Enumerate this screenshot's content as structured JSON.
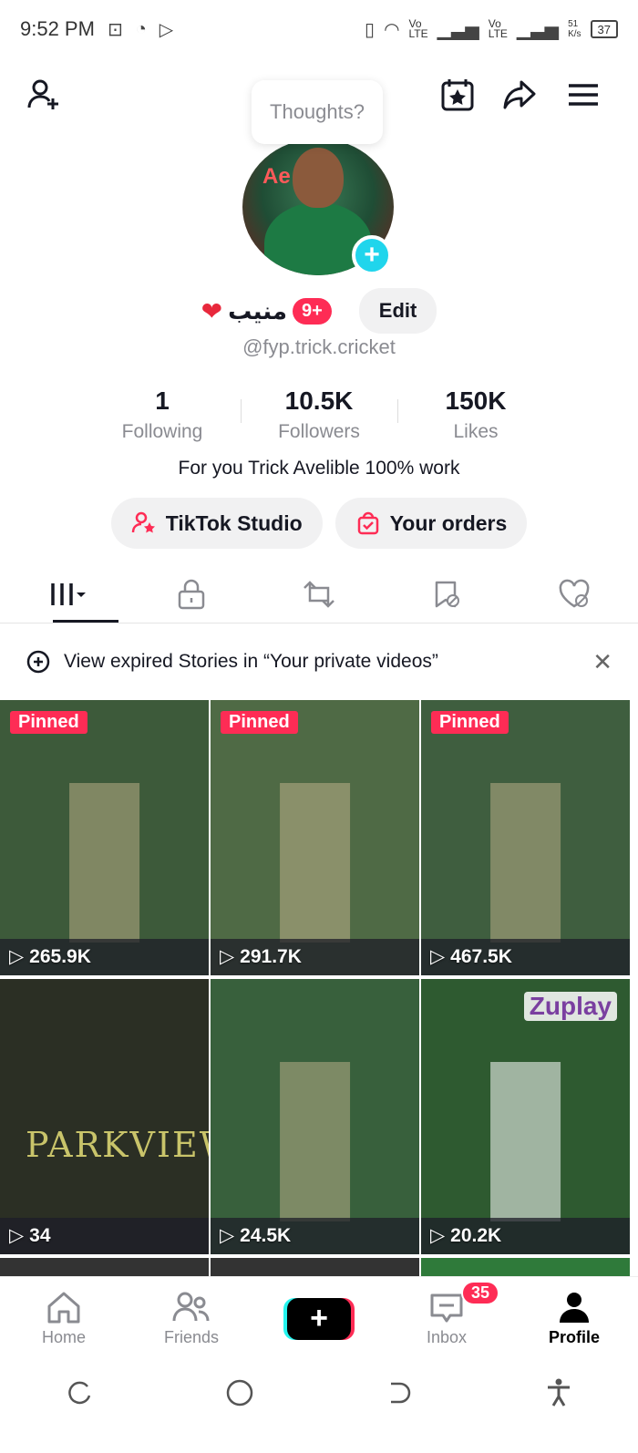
{
  "status_bar": {
    "time": "9:52 PM",
    "net1": "Vo\nLTE",
    "net2": "Vo\nLTE",
    "speed": "51\nK/s",
    "battery": "37"
  },
  "header": {
    "thoughts_placeholder": "Thoughts?"
  },
  "profile": {
    "name": "منیب",
    "notification_count": "9+",
    "edit_label": "Edit",
    "handle": "@fyp.trick.cricket",
    "bio": "For you Trick Avelible 100% work"
  },
  "stats": [
    {
      "value": "1",
      "label": "Following"
    },
    {
      "value": "10.5K",
      "label": "Followers"
    },
    {
      "value": "150K",
      "label": "Likes"
    }
  ],
  "actions": {
    "studio_label": "TikTok Studio",
    "orders_label": "Your orders"
  },
  "notice": {
    "text": "View expired Stories in “Your private videos”"
  },
  "videos": [
    {
      "pinned": "Pinned",
      "views": "265.9K",
      "bg": "#3d5a3a"
    },
    {
      "pinned": "Pinned",
      "views": "291.7K",
      "bg": "#4f6a45"
    },
    {
      "pinned": "Pinned",
      "views": "467.5K",
      "bg": "#3f5e3f"
    },
    {
      "pinned": "",
      "views": "34",
      "bg": "#2b2f24",
      "jersey": "PARKVIEW"
    },
    {
      "pinned": "",
      "views": "24.5K",
      "bg": "#38603c"
    },
    {
      "pinned": "",
      "views": "20.2K",
      "bg": "#2e5a30",
      "watermark": "Zuplay"
    }
  ],
  "bottom_nav": {
    "home": "Home",
    "friends": "Friends",
    "inbox": "Inbox",
    "inbox_badge": "35",
    "profile": "Profile"
  },
  "colors": {
    "accent": "#fe2c55",
    "cyan": "#20d5ec",
    "pill_bg": "#f1f1f2"
  }
}
